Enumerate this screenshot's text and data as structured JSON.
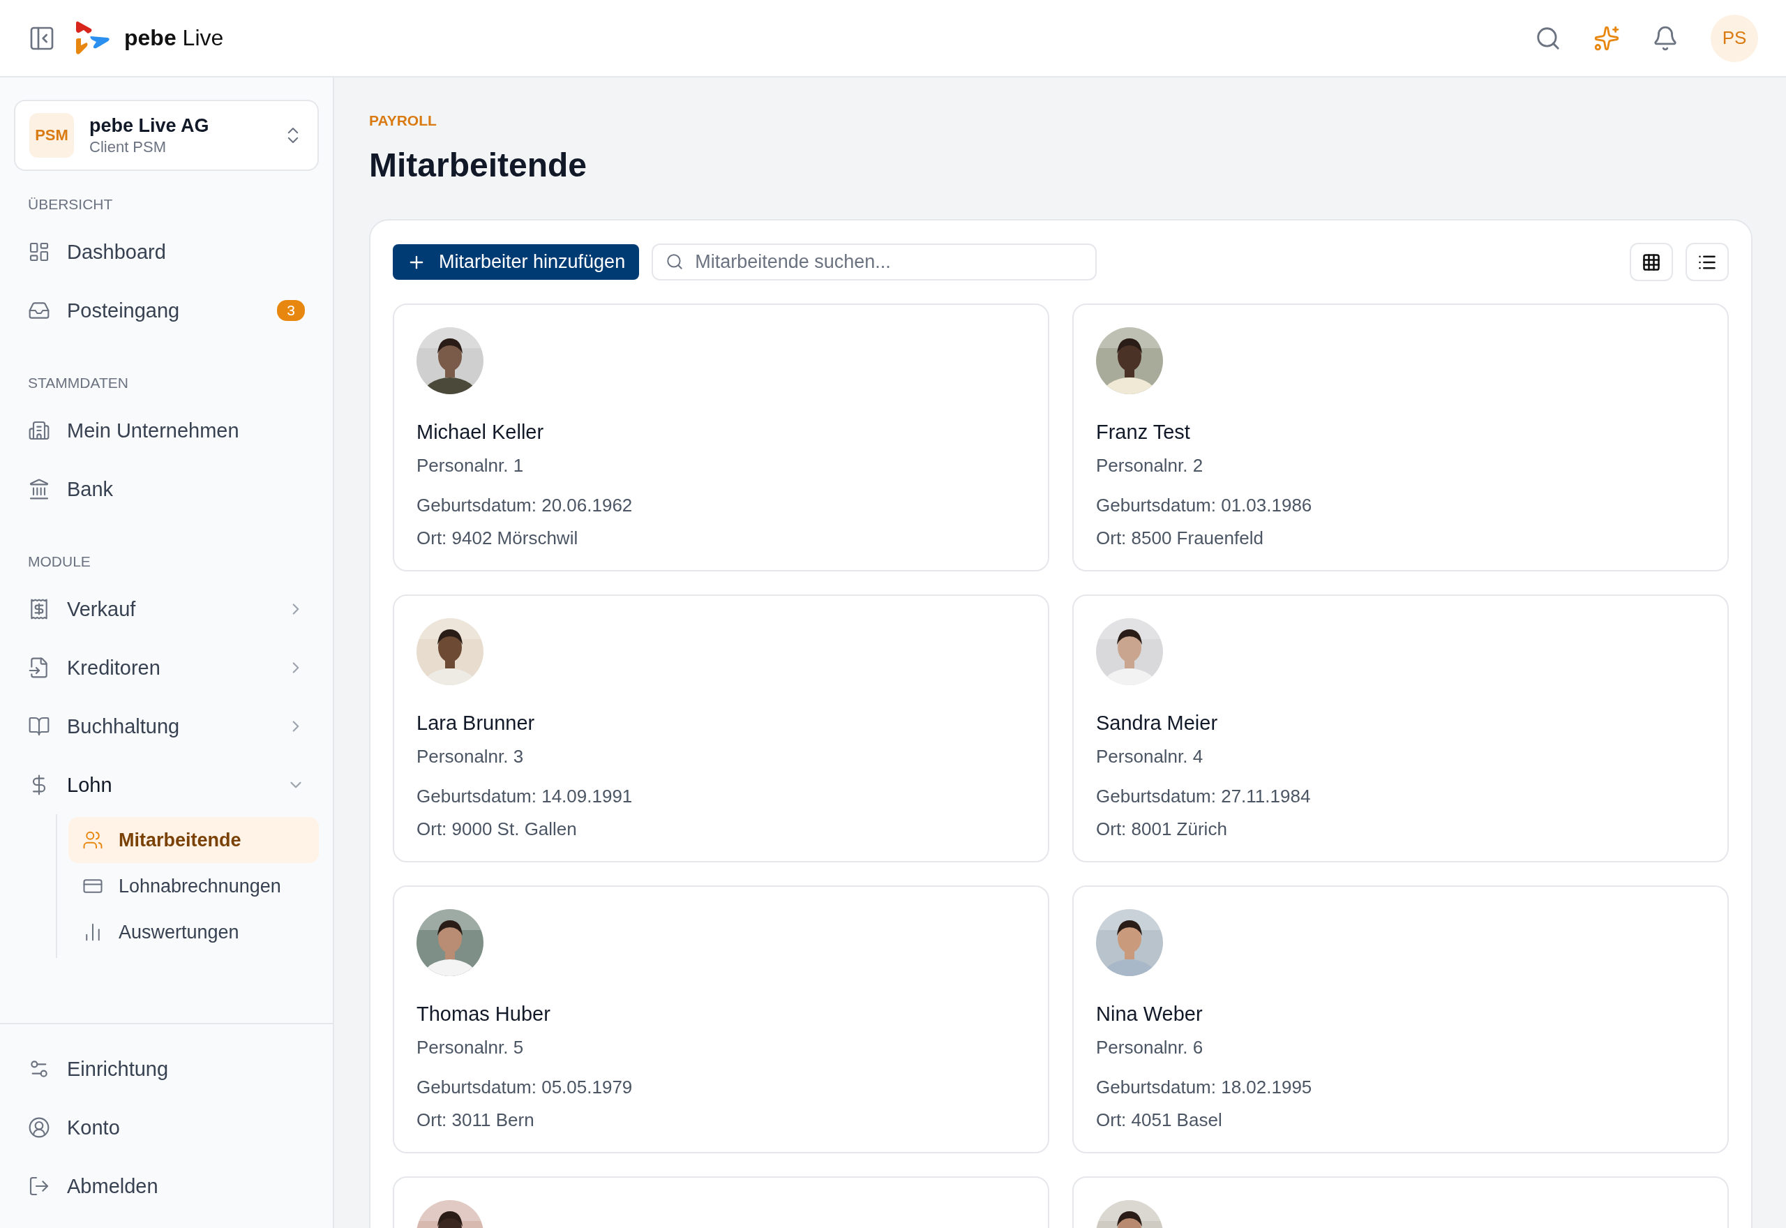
{
  "header": {
    "brand": "**pebe** Live",
    "avatar_initials": "PS"
  },
  "client": {
    "initials": "PSM",
    "name": "pebe Live AG",
    "subtitle": "Client PSM"
  },
  "sidebar": {
    "sections": [
      {
        "title": "ÜBERSICHT",
        "items": [
          {
            "label": "Dashboard"
          },
          {
            "label": "Posteingang",
            "badge": "3"
          }
        ]
      },
      {
        "title": "STAMMDATEN",
        "items": [
          {
            "label": "Mein Unternehmen"
          },
          {
            "label": "Bank"
          }
        ]
      },
      {
        "title": "MODULE",
        "items": [
          {
            "label": "Verkauf",
            "expanded": false
          },
          {
            "label": "Kreditoren",
            "expanded": false
          },
          {
            "label": "Buchhaltung",
            "expanded": false
          },
          {
            "label": "Lohn",
            "expanded": true,
            "children": [
              {
                "label": "Mitarbeitende",
                "selected": true
              },
              {
                "label": "Lohnabrechnungen",
                "selected": false
              },
              {
                "label": "Auswertungen",
                "selected": false
              }
            ]
          }
        ]
      }
    ],
    "bottom_items": [
      {
        "label": "Einrichtung"
      },
      {
        "label": "Konto"
      },
      {
        "label": "Abmelden"
      }
    ]
  },
  "main": {
    "eyebrow": "PAYROLL",
    "title": "Mitarbeitende",
    "add_button": "Mitarbeiter hinzufügen",
    "search": {
      "placeholder": "Mitarbeitende suchen..."
    },
    "employees": [
      {
        "photo": {
          "kind": "picture"
        },
        "name": "Michael Keller",
        "number": "Personalnr. 1",
        "birth": "Geburtsdatum: 20.06.1962",
        "place": "Ort: 9402 Mörschwil"
      },
      {
        "photo": {
          "kind": "picture"
        },
        "name": "Franz Test",
        "number": "Personalnr. 2",
        "birth": "Geburtsdatum: 01.03.1986",
        "place": "Ort: 8500 Frauenfeld"
      },
      {
        "photo": {
          "kind": "picture"
        },
        "name": "Lara Brunner",
        "number": "Personalnr. 3",
        "birth": "Geburtsdatum: 14.09.1991",
        "place": "Ort: 9000 St. Gallen"
      },
      {
        "photo": {
          "kind": "picture"
        },
        "name": "Sandra Meier",
        "number": "Personalnr. 4",
        "birth": "Geburtsdatum: 27.11.1984",
        "place": "Ort: 8001 Zürich"
      },
      {
        "photo": {
          "kind": "picture"
        },
        "name": "Thomas Huber",
        "number": "Personalnr. 5",
        "birth": "Geburtsdatum: 05.05.1979",
        "place": "Ort: 3011 Bern"
      },
      {
        "photo": {
          "kind": "picture"
        },
        "name": "Nina Weber",
        "number": "Personalnr. 6",
        "birth": "Geburtsdatum: 18.02.1995",
        "place": "Ort: 4051 Basel"
      },
      {
        "photo": {
          "kind": "picture"
        }
      },
      {
        "photo": {
          "kind": "picture"
        }
      }
    ]
  }
}
